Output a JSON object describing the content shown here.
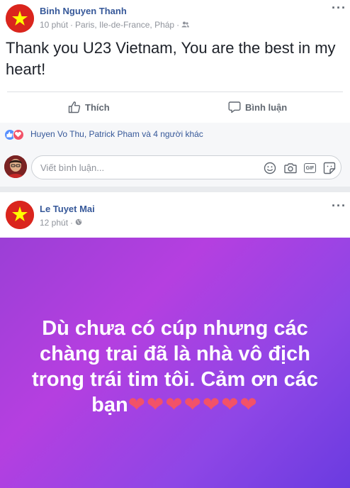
{
  "post1": {
    "author": "Binh Nguyen Thanh",
    "time": "10 phút",
    "location": "Paris, Ile-de-France, Pháp",
    "audience_icon": "friends-icon",
    "text": "Thank you U23 Vietnam, You are the best in my heart!",
    "actions": {
      "like": "Thích",
      "comment": "Bình luận"
    },
    "reactions_text": "Huyen Vo Thu, Patrick Pham và 4 người khác",
    "comment_placeholder": "Viết bình luận..."
  },
  "post2": {
    "author": "Le Tuyet Mai",
    "time": "12 phút",
    "audience_icon": "globe-icon",
    "banner_text": "Dù chưa có cúp nhưng các chàng trai đã là nhà vô địch trong trái tim tôi. Cảm ơn các bạn",
    "banner_hearts": "❤❤❤❤❤❤❤"
  },
  "colors": {
    "link": "#365899",
    "flag_red": "#da251d",
    "flag_star": "#ffff00",
    "banner_start": "#9b3fd6",
    "banner_end": "#6a3be0"
  }
}
